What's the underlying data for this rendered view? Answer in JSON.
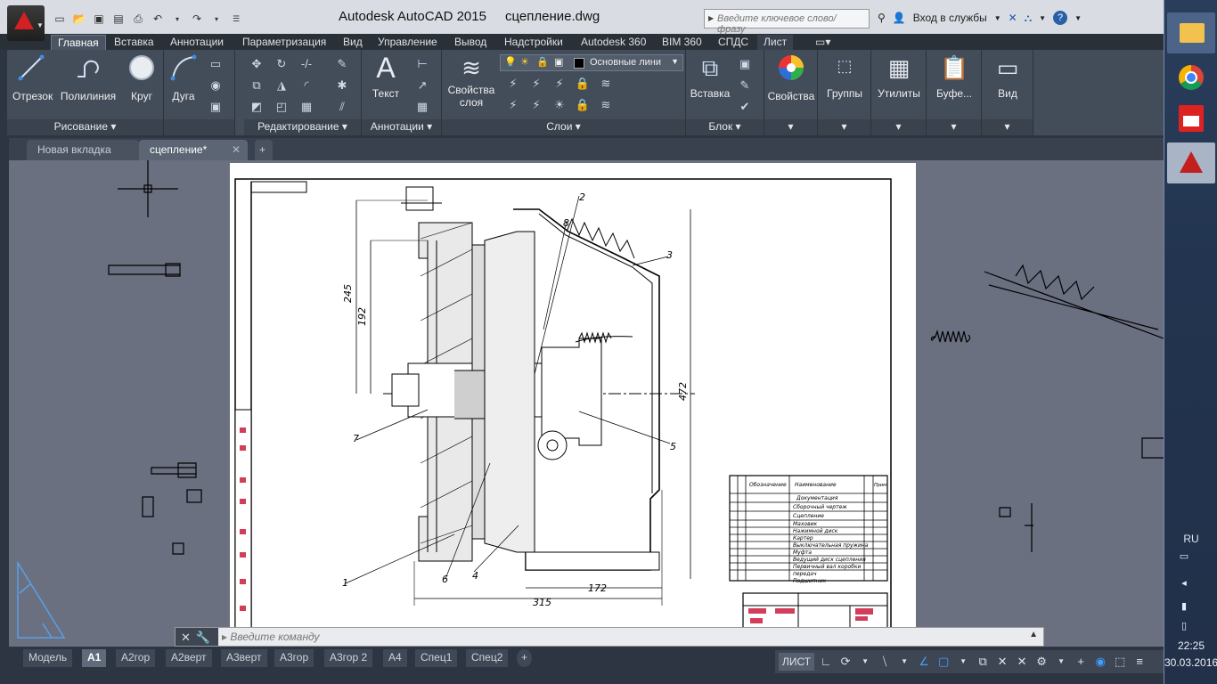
{
  "window": {
    "app_title": "Autodesk AutoCAD 2015",
    "file_title": "сцепление.dwg",
    "search_placeholder": "Введите ключевое слово/фразу",
    "sign_in": "Вход в службы"
  },
  "ribbon_tabs": [
    "Главная",
    "Вставка",
    "Аннотации",
    "Параметризация",
    "Вид",
    "Управление",
    "Вывод",
    "Надстройки",
    "Autodesk 360",
    "BIM 360",
    "СПДС",
    "Лист"
  ],
  "ribbon": {
    "draw": {
      "title": "Рисование",
      "line": "Отрезок",
      "polyline": "Полилиния",
      "circle": "Круг",
      "arc": "Дуга"
    },
    "modify": {
      "title": "Редактирование"
    },
    "annotation": {
      "title": "Аннотации",
      "text": "Текст"
    },
    "layers": {
      "title": "Слои",
      "properties": "Свойства\nслоя",
      "properties_line1": "Свойства",
      "properties_line2": "слоя",
      "current_layer": "Основные лини"
    },
    "block": {
      "title": "Блок",
      "insert": "Вставка"
    },
    "properties": {
      "label": "Свойства"
    },
    "groups": {
      "label": "Группы"
    },
    "utilities": {
      "label": "Утилиты"
    },
    "clipboard": {
      "label": "Буфе..."
    },
    "view": {
      "label": "Вид"
    }
  },
  "file_tabs": {
    "new_tab": "Новая вкладка",
    "current": "сцепление*"
  },
  "drawing": {
    "dims": {
      "d245": "245",
      "d192": "192",
      "d472": "472",
      "d315": "315",
      "d172": "172"
    },
    "callouts": [
      "1",
      "2",
      "3",
      "4",
      "5",
      "6",
      "7",
      "8"
    ],
    "spec_header": {
      "designation": "Обозначение",
      "name": "Наименование",
      "note": "Прим."
    },
    "spec_rows": [
      "Документация",
      "Сборочный чертеж",
      "Сцепление",
      "Маховик",
      "Нажимной диск",
      "Картер",
      "Выключательная пружина",
      "Муфта",
      "Ведущий диск сцепления",
      "Первичный вал коробки",
      "передач",
      "Подшипник"
    ]
  },
  "command_prompt": "Введите команду",
  "layout_tabs": [
    "Модель",
    "A1",
    "A2гор",
    "A2верт",
    "A3верт",
    "A3гор",
    "A3гор 2",
    "A4",
    "Спец1",
    "Спец2"
  ],
  "active_layout": "A1",
  "status": {
    "model_label": "ЛИСТ"
  },
  "taskbar": {
    "lang": "RU",
    "time": "22:25",
    "date": "30.03.2016"
  }
}
